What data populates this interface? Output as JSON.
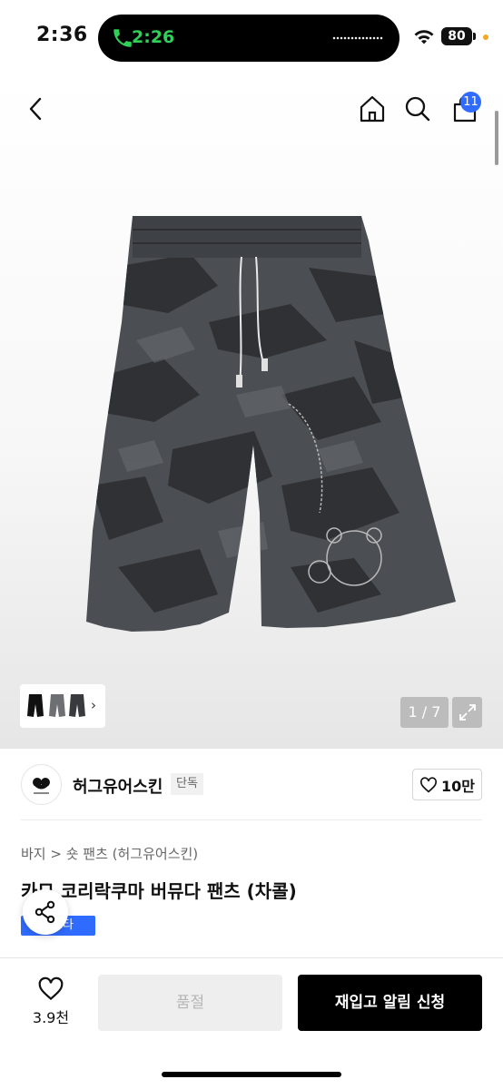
{
  "status_bar": {
    "time": "2:36",
    "call_time": "2:26",
    "battery": "80"
  },
  "header": {
    "cart_count": "11"
  },
  "gallery": {
    "pager": "1 / 7"
  },
  "brand": {
    "name": "허그유어스킨",
    "tag": "단독",
    "likes": "10만"
  },
  "product": {
    "breadcrumb": "바지 > 숏 팬츠 (허그유어스킨)",
    "title": "카모 코리락쿠마 버뮤다 팬츠 (차콜)",
    "promo_badge": "스타"
  },
  "bottom_bar": {
    "wish_count": "3.9천",
    "soldout_label": "품절",
    "restock_label": "재입고 알림 신청"
  },
  "colors": {
    "accent_blue": "#2f6bff",
    "call_green": "#2fd158",
    "primary_button": "#000000"
  }
}
